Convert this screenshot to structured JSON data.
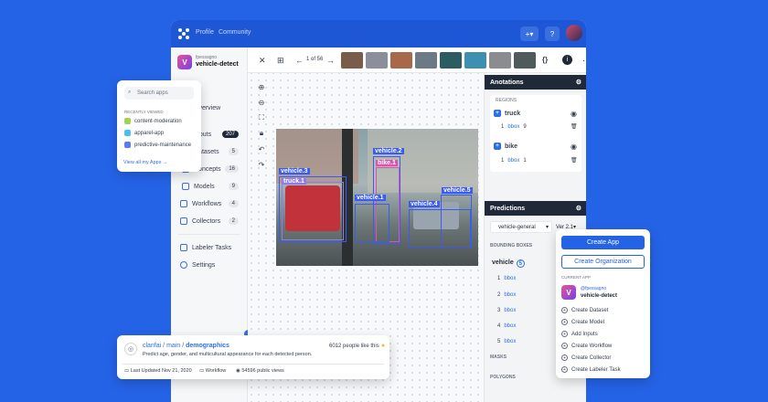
{
  "topnav": {
    "profile": "Profile",
    "community": "Community"
  },
  "app": {
    "user": "fpessagno",
    "name": "vehicle-detect",
    "initial": "V"
  },
  "sidebar": {
    "items": [
      {
        "label": "Overview",
        "count": ""
      },
      {
        "label": "Inputs",
        "count": "207"
      },
      {
        "label": "Datasets",
        "count": "5"
      },
      {
        "label": "Concepts",
        "count": "16"
      },
      {
        "label": "Models",
        "count": "9"
      },
      {
        "label": "Workflows",
        "count": "4"
      },
      {
        "label": "Collectors",
        "count": "2"
      },
      {
        "label": "Labeler Tasks",
        "count": ""
      },
      {
        "label": "Settings",
        "count": ""
      }
    ]
  },
  "toolbar": {
    "pager": "1 of 56"
  },
  "annotations": {
    "title": "Anotations",
    "regions": "REGIONS",
    "rows": [
      {
        "idx": "1",
        "name": "truck",
        "type": "bbox",
        "count": "9"
      },
      {
        "idx": "1",
        "name": "bike",
        "type": "bbox",
        "count": "1"
      }
    ]
  },
  "predictions": {
    "title": "Predictions",
    "model": "vehicle-general",
    "version": "Ver 2.1",
    "bbox_label": "BOUNDING BOXES",
    "concept": "vehicle",
    "concept_count": "5",
    "rows": [
      "1",
      "2",
      "3",
      "4",
      "5"
    ],
    "type": "bbox",
    "masks": "MASKS",
    "polygons": "POLYGONS"
  },
  "boxes": [
    {
      "label": "vehicle.3",
      "color": "#3b5cf0"
    },
    {
      "label": "truck.1",
      "color": "#8b7cf0"
    },
    {
      "label": "vehicle.2",
      "color": "#3b5cf0"
    },
    {
      "label": "bike.1",
      "color": "#e052b0"
    },
    {
      "label": "vehicle.1",
      "color": "#3b5cf0"
    },
    {
      "label": "vehicle.4",
      "color": "#3b5cf0"
    },
    {
      "label": "vehicle.5",
      "color": "#3b5cf0"
    }
  ],
  "apps_popup": {
    "search": "Search apps",
    "recent": "RECENTLY VIEWED",
    "items": [
      "content-moderation",
      "apparel-app",
      "predictive-maintenance"
    ],
    "view_all": "View all my Apps →"
  },
  "model_card": {
    "owner": "clarifai",
    "branch": "main",
    "name": "demographics",
    "likes": "6012 people like this",
    "desc": "Predict age, gender, and multicultural appearance for each detected person.",
    "updated": "Last Updated Nov 21, 2020",
    "kind": "Workflow",
    "views": "54596 public views"
  },
  "create_popup": {
    "create_app": "Create App",
    "create_org": "Create Organization",
    "current": "CURRENT APP",
    "user": "@fpessagno",
    "app": "vehicle-detect",
    "items": [
      "Create Dataset",
      "Create Model",
      "Add Inputs",
      "Create Workflow",
      "Create Collector",
      "Create Labeler Task"
    ]
  }
}
